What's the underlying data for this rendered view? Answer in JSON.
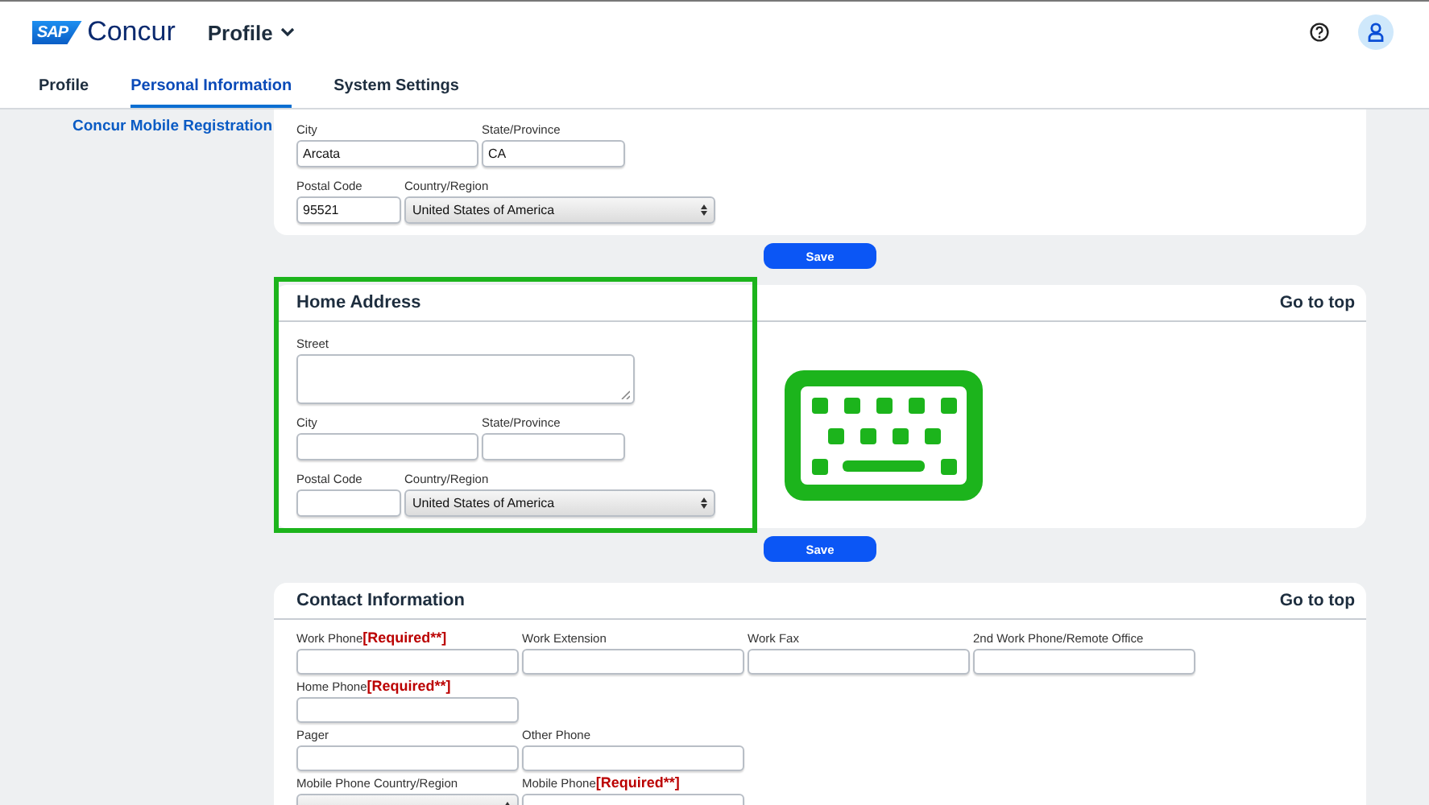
{
  "header": {
    "logo_badge": "SAP",
    "logo_text": "Concur",
    "menu": "Profile"
  },
  "tabs": [
    {
      "label": "Profile",
      "selected": false
    },
    {
      "label": "Personal Information",
      "selected": true
    },
    {
      "label": "System Settings",
      "selected": false
    }
  ],
  "sidebar": {
    "links": [
      "Concur Mobile Registration"
    ]
  },
  "sections": [
    {
      "rows": [
        [
          {
            "label": "City",
            "kind": "text",
            "value": "Arcata"
          },
          {
            "label": "State/Province",
            "kind": "text",
            "value": "CA"
          }
        ],
        [
          {
            "label": "Postal Code",
            "kind": "text",
            "value": "95521"
          },
          {
            "label": "Country/Region",
            "kind": "select",
            "value": "United States of America"
          }
        ]
      ],
      "save_button": "Save"
    },
    {
      "title": "Home Address",
      "go_to_top": "Go to top",
      "highlighted": true,
      "annotation": {
        "kind": "keyboard"
      },
      "rows": [
        [
          {
            "label": "Street",
            "kind": "textarea"
          }
        ],
        [
          {
            "label": "City",
            "kind": "text"
          },
          {
            "label": "State/Province",
            "kind": "text"
          }
        ],
        [
          {
            "label": "Postal Code",
            "kind": "text"
          },
          {
            "label": "Country/Region",
            "kind": "select",
            "value": "United States of America"
          }
        ]
      ],
      "save_button": "Save"
    },
    {
      "title": "Contact Information",
      "go_to_top": "Go to top",
      "rows": [
        [
          {
            "label": "Work Phone",
            "required": "[Required**]",
            "kind": "text"
          },
          {
            "label": "Work Extension",
            "kind": "text"
          },
          {
            "label": "Work Fax",
            "kind": "text"
          },
          {
            "label": "2nd Work Phone/Remote Office",
            "kind": "text"
          }
        ],
        [
          {
            "label": "Home Phone",
            "required": "[Required**]",
            "kind": "text"
          }
        ],
        [
          {
            "label": "Pager",
            "kind": "text"
          },
          {
            "label": "Other Phone",
            "kind": "text"
          }
        ],
        [
          {
            "label": "Mobile Phone Country/Region",
            "kind": "select"
          },
          {
            "label": "Mobile Phone",
            "required": "[Required**]",
            "kind": "text"
          }
        ]
      ]
    }
  ]
}
